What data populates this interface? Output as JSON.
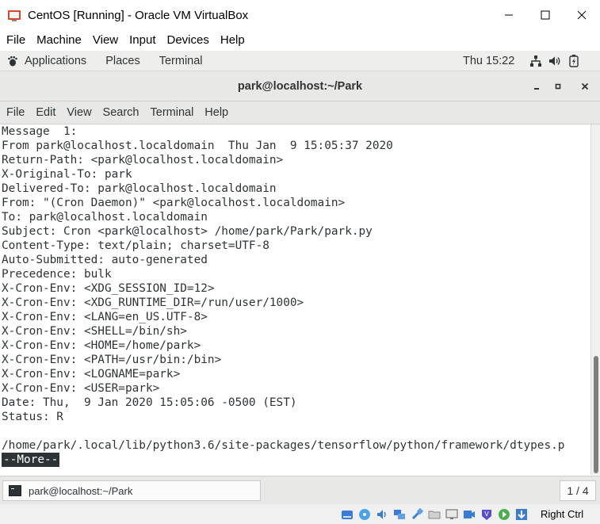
{
  "window": {
    "title": "CentOS [Running] - Oracle VM VirtualBox"
  },
  "vbox_menu": [
    "File",
    "Machine",
    "View",
    "Input",
    "Devices",
    "Help"
  ],
  "gnome_topbar": {
    "applications": "Applications",
    "places": "Places",
    "terminal": "Terminal",
    "clock": "Thu 15:22"
  },
  "terminal_window": {
    "title": "park@localhost:~/Park",
    "menu": [
      "File",
      "Edit",
      "View",
      "Search",
      "Terminal",
      "Help"
    ],
    "lines": [
      "Message  1:",
      "From park@localhost.localdomain  Thu Jan  9 15:05:37 2020",
      "Return-Path: <park@localhost.localdomain>",
      "X-Original-To: park",
      "Delivered-To: park@localhost.localdomain",
      "From: \"(Cron Daemon)\" <park@localhost.localdomain>",
      "To: park@localhost.localdomain",
      "Subject: Cron <park@localhost> /home/park/Park/park.py",
      "Content-Type: text/plain; charset=UTF-8",
      "Auto-Submitted: auto-generated",
      "Precedence: bulk",
      "X-Cron-Env: <XDG_SESSION_ID=12>",
      "X-Cron-Env: <XDG_RUNTIME_DIR=/run/user/1000>",
      "X-Cron-Env: <LANG=en_US.UTF-8>",
      "X-Cron-Env: <SHELL=/bin/sh>",
      "X-Cron-Env: <HOME=/home/park>",
      "X-Cron-Env: <PATH=/usr/bin:/bin>",
      "X-Cron-Env: <LOGNAME=park>",
      "X-Cron-Env: <USER=park>",
      "Date: Thu,  9 Jan 2020 15:05:06 -0500 (EST)",
      "Status: R",
      "",
      "/home/park/.local/lib/python3.6/site-packages/tensorflow/python/framework/dtypes.p"
    ],
    "pager_prompt": "--More--"
  },
  "taskbar": {
    "task_label": "park@localhost:~/Park",
    "workspace": "1 / 4"
  },
  "vbox_status": {
    "host_key": "Right Ctrl"
  }
}
